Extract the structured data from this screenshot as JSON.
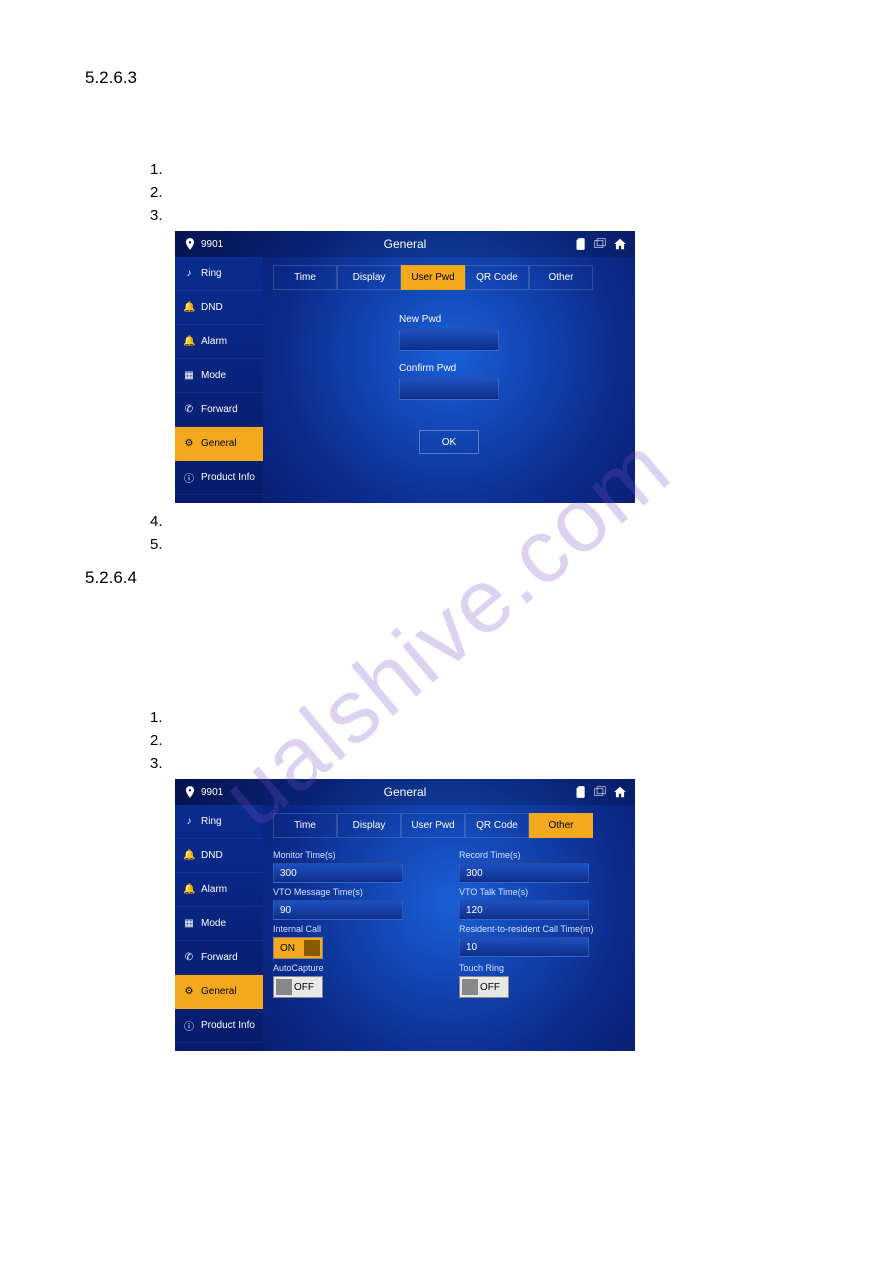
{
  "watermark": "ualshive.com",
  "sections": {
    "first": "5.2.6.3",
    "second": "5.2.6.4"
  },
  "lists": {
    "a": [
      "1.",
      "2.",
      "3."
    ],
    "b": [
      "4.",
      "5."
    ],
    "c": [
      "1.",
      "2.",
      "3."
    ]
  },
  "device": {
    "room": "9901",
    "title": "General",
    "sidebar": [
      {
        "icon": "note",
        "label": "Ring"
      },
      {
        "icon": "bell",
        "label": "DND"
      },
      {
        "icon": "bell2",
        "label": "Alarm"
      },
      {
        "icon": "grid",
        "label": "Mode"
      },
      {
        "icon": "phone",
        "label": "Forward"
      },
      {
        "icon": "gear",
        "label": "General"
      },
      {
        "icon": "info",
        "label": "Product Info"
      }
    ],
    "tabs": [
      "Time",
      "Display",
      "User Pwd",
      "QR Code",
      "Other"
    ]
  },
  "screen1": {
    "activeTab": "User Pwd",
    "fields": {
      "new_pwd": "New Pwd",
      "confirm_pwd": "Confirm Pwd"
    },
    "ok": "OK"
  },
  "screen2": {
    "activeTab": "Other",
    "fields": {
      "monitor_time": {
        "label": "Monitor Time(s)",
        "value": "300"
      },
      "record_time": {
        "label": "Record Time(s)",
        "value": "300"
      },
      "vto_msg": {
        "label": "VTO Message Time(s)",
        "value": "90"
      },
      "vto_talk": {
        "label": "VTO Talk Time(s)",
        "value": "120"
      },
      "internal_call": {
        "label": "Internal Call",
        "value": "ON",
        "state": "on"
      },
      "res_call": {
        "label": "Resident-to-resident Call Time(m)",
        "value": "10"
      },
      "autocapture": {
        "label": "AutoCapture",
        "value": "OFF",
        "state": "off"
      },
      "touch_ring": {
        "label": "Touch Ring",
        "value": "OFF",
        "state": "off"
      }
    }
  }
}
